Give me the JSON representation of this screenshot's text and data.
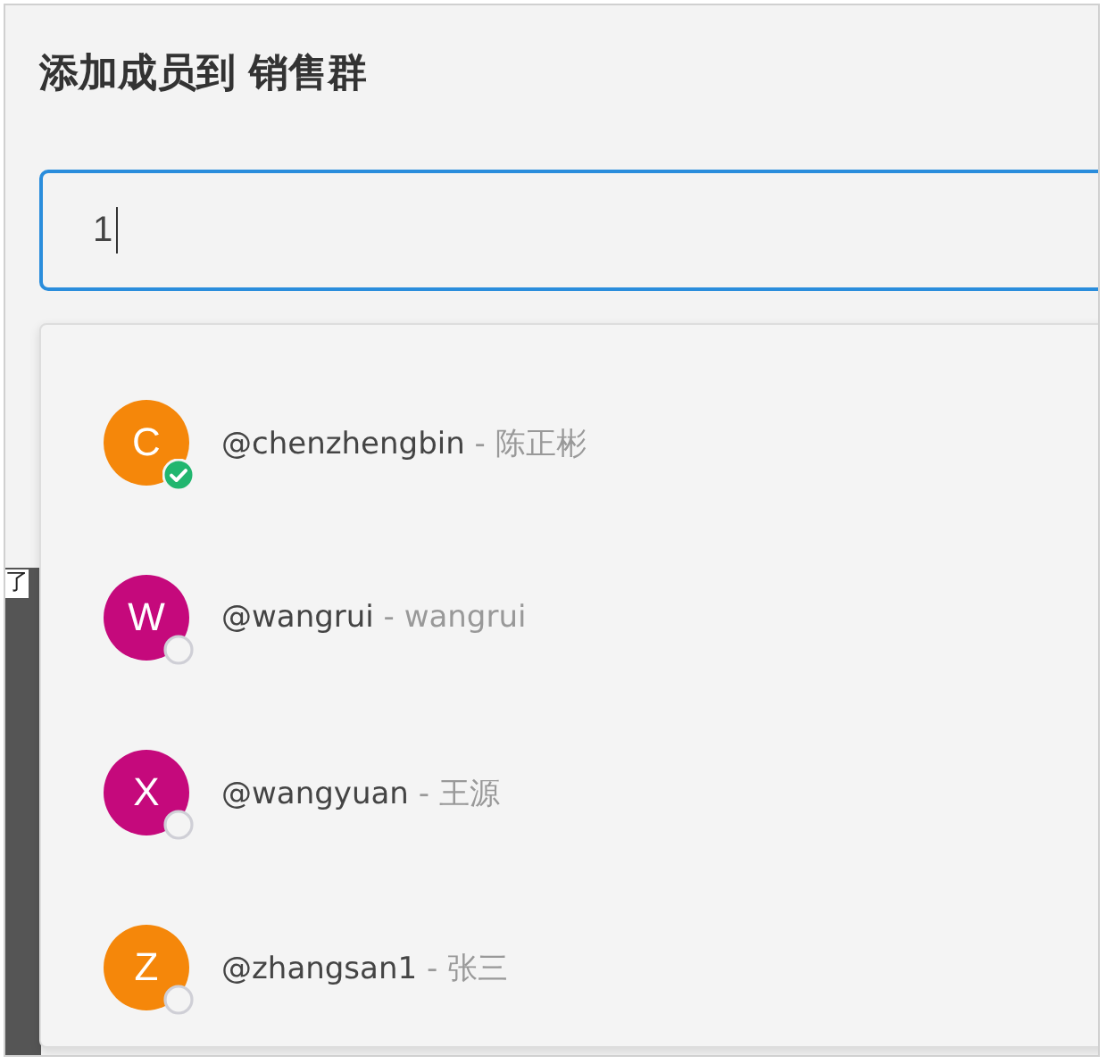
{
  "dialog": {
    "title": "添加成员到 销售群"
  },
  "search": {
    "value": "1"
  },
  "background_text": "了",
  "members": [
    {
      "initial": "C",
      "color": "#f5870a",
      "handle": "@chenzhengbin",
      "name": "- 陈正彬",
      "selected": true
    },
    {
      "initial": "W",
      "color": "#c5097c",
      "handle": "@wangrui",
      "name": "- wangrui",
      "selected": false
    },
    {
      "initial": "X",
      "color": "#c5097c",
      "handle": "@wangyuan",
      "name": "- 王源",
      "selected": false
    },
    {
      "initial": "Z",
      "color": "#f5870a",
      "handle": "@zhangsan1",
      "name": "- 张三",
      "selected": false
    }
  ]
}
